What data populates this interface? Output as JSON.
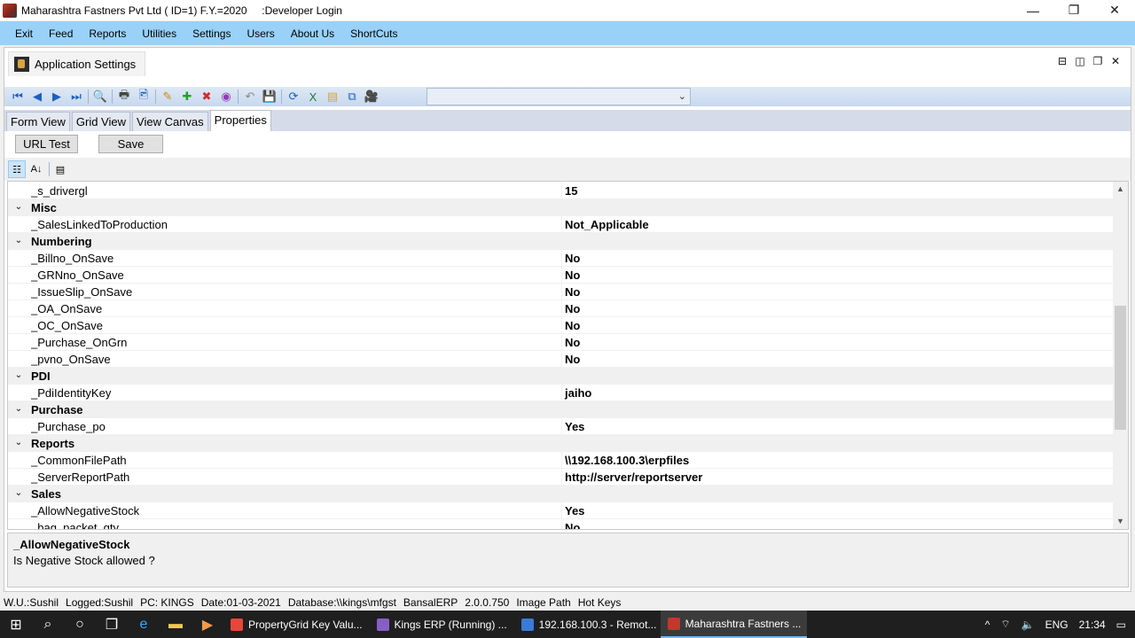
{
  "window": {
    "title": "Maharashtra Fastners Pvt Ltd ( ID=1) F.Y.=2020     :Developer Login",
    "controls": {
      "minimize": "—",
      "maximize": "❐",
      "close": "✕"
    }
  },
  "menubar": {
    "items": [
      {
        "label": "Exit"
      },
      {
        "label": "Feed"
      },
      {
        "label": "Reports"
      },
      {
        "label": "Utilities"
      },
      {
        "label": "Settings"
      },
      {
        "label": "Users"
      },
      {
        "label": "About Us"
      },
      {
        "label": "ShortCuts"
      }
    ]
  },
  "document_tab": {
    "label": "Application Settings"
  },
  "mdi_controls": {
    "tile_h": "⊟",
    "tile_v": "◫",
    "restore": "❐",
    "close": "✕"
  },
  "toolbar": {
    "icons": [
      {
        "name": "first-record-icon",
        "glyph": "⏮",
        "color": "#1e5fbf"
      },
      {
        "name": "previous-record-icon",
        "glyph": "◀",
        "color": "#1e5fbf"
      },
      {
        "name": "next-record-icon",
        "glyph": "▶",
        "color": "#1e5fbf"
      },
      {
        "name": "last-record-icon",
        "glyph": "⏭",
        "color": "#1e5fbf"
      },
      {
        "name": "find-icon",
        "glyph": "🔍",
        "color": "#1e5fbf"
      },
      {
        "name": "print-icon",
        "glyph": "🖶",
        "color": "#444444"
      },
      {
        "name": "print-preview-icon",
        "glyph": "🖻",
        "color": "#1e5fbf"
      },
      {
        "name": "edit-icon",
        "glyph": "✎",
        "color": "#c58b0a"
      },
      {
        "name": "add-icon",
        "glyph": "✚",
        "color": "#22a322"
      },
      {
        "name": "delete-icon",
        "glyph": "✖",
        "color": "#d42a2a"
      },
      {
        "name": "view-icon",
        "glyph": "◉",
        "color": "#8e3bb8"
      },
      {
        "name": "undo-icon",
        "glyph": "↶",
        "color": "#8a8a8a"
      },
      {
        "name": "save-disk-icon",
        "glyph": "💾",
        "color": "#8a8a8a"
      },
      {
        "name": "refresh-icon",
        "glyph": "⟳",
        "color": "#1e5fbf"
      },
      {
        "name": "excel-icon",
        "glyph": "X",
        "color": "#1d7a3a"
      },
      {
        "name": "note-icon",
        "glyph": "▤",
        "color": "#d9a441"
      },
      {
        "name": "copy-icon",
        "glyph": "⧉",
        "color": "#1e5fbf"
      },
      {
        "name": "camera-icon",
        "glyph": "🎥",
        "color": "#222222"
      }
    ],
    "combo_value": ""
  },
  "view_tabs": [
    {
      "label": "Form View",
      "active": false
    },
    {
      "label": "Grid View",
      "active": false
    },
    {
      "label": "View Canvas",
      "active": false
    },
    {
      "label": "Properties",
      "active": true
    }
  ],
  "buttons": {
    "url_test": "URL Test",
    "save": "Save"
  },
  "pg_toolbar": {
    "categorized": "☷",
    "alphabetical": "A↓",
    "property_pages": "▤"
  },
  "property_rows": [
    {
      "kind": "prop",
      "name": "_s_drivergl",
      "value": "15"
    },
    {
      "kind": "cat",
      "name": "Misc"
    },
    {
      "kind": "prop",
      "name": "_SalesLinkedToProduction",
      "value": "Not_Applicable"
    },
    {
      "kind": "cat",
      "name": "Numbering"
    },
    {
      "kind": "prop",
      "name": "_Billno_OnSave",
      "value": "No"
    },
    {
      "kind": "prop",
      "name": "_GRNno_OnSave",
      "value": "No"
    },
    {
      "kind": "prop",
      "name": "_IssueSlip_OnSave",
      "value": "No"
    },
    {
      "kind": "prop",
      "name": "_OA_OnSave",
      "value": "No"
    },
    {
      "kind": "prop",
      "name": "_OC_OnSave",
      "value": "No"
    },
    {
      "kind": "prop",
      "name": "_Purchase_OnGrn",
      "value": "No"
    },
    {
      "kind": "prop",
      "name": "_pvno_OnSave",
      "value": "No"
    },
    {
      "kind": "cat",
      "name": "PDI"
    },
    {
      "kind": "prop",
      "name": "_PdiIdentityKey",
      "value": "jaiho"
    },
    {
      "kind": "cat",
      "name": "Purchase"
    },
    {
      "kind": "prop",
      "name": "_Purchase_po",
      "value": "Yes"
    },
    {
      "kind": "cat",
      "name": "Reports"
    },
    {
      "kind": "prop",
      "name": "_CommonFilePath",
      "value": "\\\\192.168.100.3\\erpfiles"
    },
    {
      "kind": "prop",
      "name": "_ServerReportPath",
      "value": "http://server/reportserver"
    },
    {
      "kind": "cat",
      "name": "Sales"
    },
    {
      "kind": "prop",
      "name": "_AllowNegativeStock",
      "value": "Yes"
    },
    {
      "kind": "prop",
      "name": "_bag_packet_qty",
      "value": "No"
    }
  ],
  "help": {
    "title": "_AllowNegativeStock",
    "description": "Is Negative Stock allowed ?"
  },
  "statusbar": [
    "W.U.:Sushil",
    "Logged:Sushil",
    "PC: KINGS",
    "Date:01-03-2021",
    "Database:\\\\kings\\mfgst",
    "BansalERP",
    "2.0.0.750",
    "Image Path",
    "Hot Keys"
  ],
  "taskbar": {
    "apps": [
      {
        "label": "PropertyGrid Key Valu...",
        "color": "#e8453c",
        "active": false
      },
      {
        "label": "Kings ERP (Running) ...",
        "color": "#865fc5",
        "active": false
      },
      {
        "label": "192.168.100.3 - Remot...",
        "color": "#3a7bd5",
        "active": false
      },
      {
        "label": "Maharashtra Fastners ...",
        "color": "#c0392b",
        "active": true
      }
    ],
    "tray": {
      "chevron": "^",
      "language": "ENG",
      "time": "21:34"
    }
  }
}
